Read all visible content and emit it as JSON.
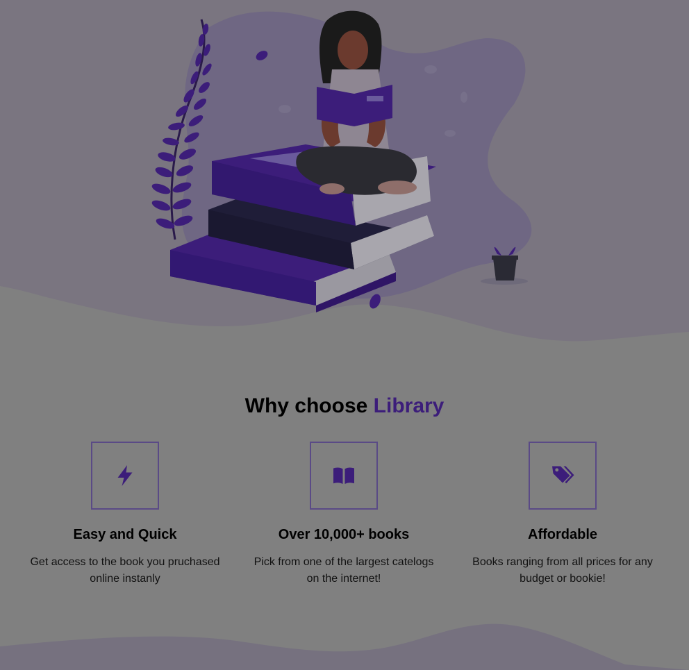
{
  "hero": {
    "illustration": "woman-reading-on-books-illustration"
  },
  "why": {
    "title_prefix": "Why choose ",
    "title_accent": "Library"
  },
  "features": [
    {
      "icon": "lightning-bolt-icon",
      "title": "Easy and Quick",
      "description": "Get access to the book you pruchased online instanly"
    },
    {
      "icon": "open-book-icon",
      "title": "Over 10,000+ books",
      "description": "Pick from one of the largest catelogs on the internet!"
    },
    {
      "icon": "price-tags-icon",
      "title": "Affordable",
      "description": "Books ranging from all prices for any budget or bookie!"
    }
  ],
  "colors": {
    "background": "#808080",
    "accent": "#3c1d7a",
    "wave": "#76717f",
    "blob": "#6f6783"
  }
}
